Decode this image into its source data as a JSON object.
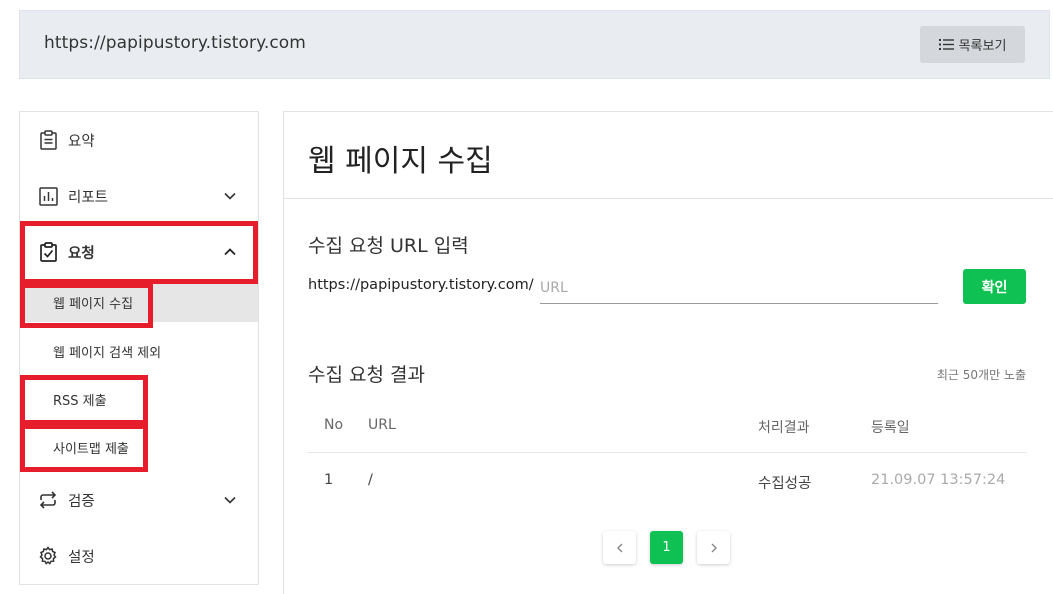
{
  "header": {
    "site_url": "https://papipustory.tistory.com",
    "list_button_label": "목록보기"
  },
  "sidebar": {
    "items": [
      {
        "label": "요약",
        "icon": "clipboard-icon"
      },
      {
        "label": "리포트",
        "icon": "chart-icon"
      },
      {
        "label": "요청",
        "icon": "clipboard-check-icon"
      },
      {
        "label": "검증",
        "icon": "repeat-icon"
      },
      {
        "label": "설정",
        "icon": "gear-icon"
      }
    ],
    "sub_items": [
      {
        "label": "웹 페이지 수집"
      },
      {
        "label": "웹 페이지 검색 제외"
      },
      {
        "label": "RSS 제출"
      },
      {
        "label": "사이트맵 제출"
      }
    ]
  },
  "main": {
    "title": "웹 페이지 수집",
    "form_title": "수집 요청 URL 입력",
    "url_prefix": "https://papipustory.tistory.com/",
    "url_placeholder": "URL",
    "confirm_label": "확인",
    "results_title": "수집 요청 결과",
    "recent_note": "최근 50개만 노출",
    "table": {
      "headers": [
        "No",
        "URL",
        "처리결과",
        "등록일"
      ],
      "rows": [
        {
          "no": "1",
          "url": "/",
          "result": "수집성공",
          "date": "21.09.07 13:57:24"
        }
      ]
    },
    "pagination": {
      "current": "1"
    }
  },
  "colors": {
    "accent_green": "#0fc153",
    "highlight_red": "#e61e2b",
    "topbar_bg": "#e9edf1"
  }
}
